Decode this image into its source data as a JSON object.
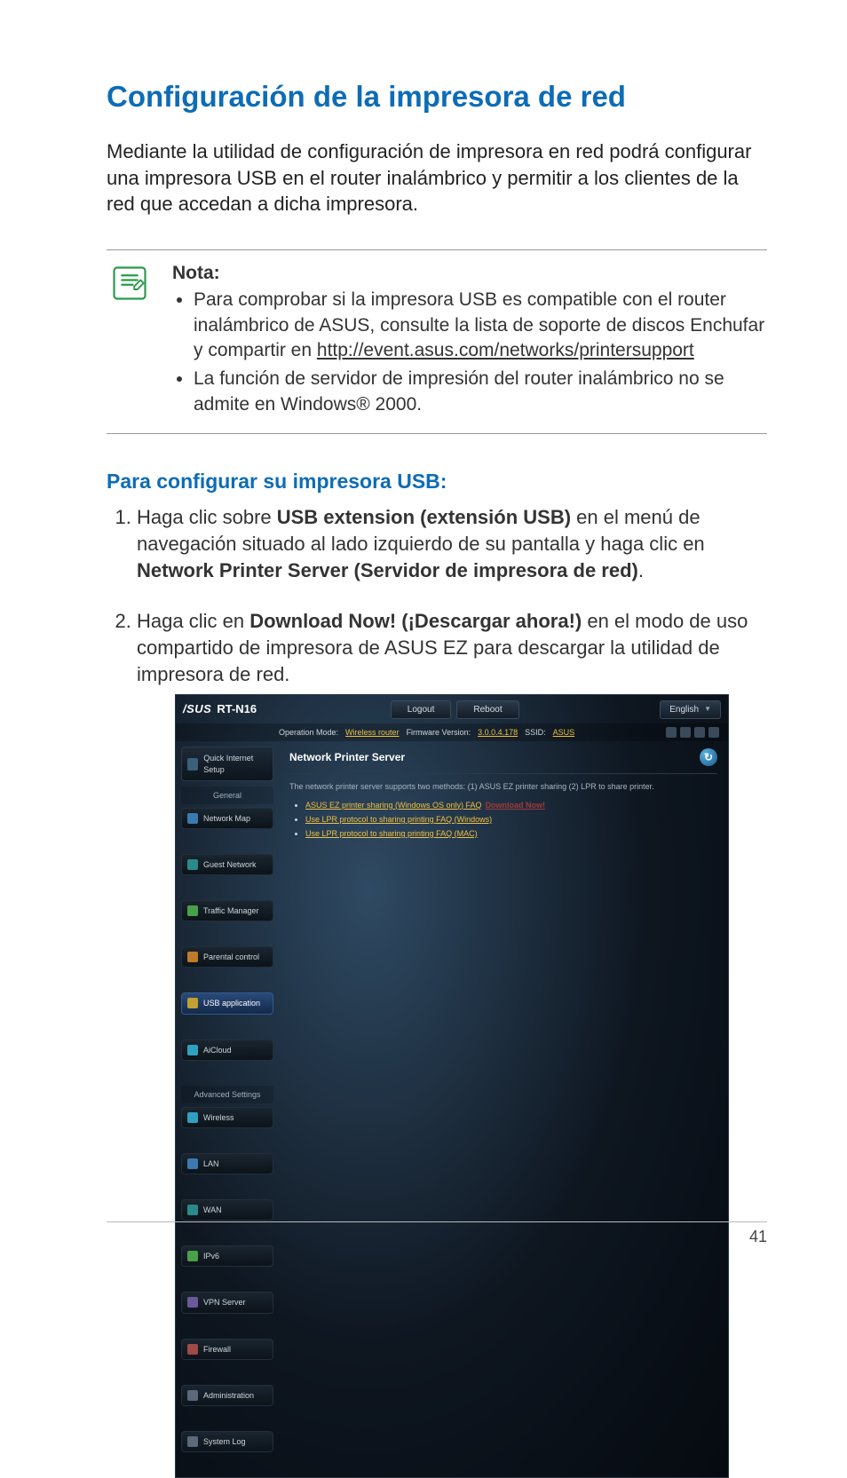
{
  "title": "Configuración de la impresora de red",
  "intro": "Mediante la utilidad de configuración de impresora en red podrá configurar una impresora USB en el router inalámbrico y permitir a los clientes de la red que accedan a dicha impresora.",
  "note": {
    "heading": "Nota:",
    "bullet1_pre": "Para comprobar si la impresora USB es compatible con el router inalámbrico de ASUS, consulte la lista de soporte de discos Enchufar y compartir en ",
    "bullet1_link": "http://event.asus.com/networks/printersupport",
    "bullet2": "La función de servidor de impresión del router inalámbrico no se admite en Windows® 2000."
  },
  "subheading": "Para configurar su impresora USB:",
  "step1": {
    "pre": "Haga clic sobre ",
    "bold1": "USB extension (extensión USB)",
    "mid": " en el menú de navegación situado al lado izquierdo de su pantalla y haga clic en ",
    "bold2": "Network Printer Server (Servidor de impresora de red)",
    "post": "."
  },
  "step2": {
    "pre": "Haga clic en ",
    "bold1": "Download Now! (¡Descargar ahora!)",
    "post": " en el modo de uso compartido de impresora de ASUS EZ para descargar la utilidad de impresora de red."
  },
  "screenshot": {
    "brand": "/SUS",
    "model": "RT-N16",
    "btn_logout": "Logout",
    "btn_reboot": "Reboot",
    "lang": "English",
    "info_mode_label": "Operation Mode:",
    "info_mode_value": "Wireless router",
    "info_fw_label": "Firmware Version:",
    "info_fw_value": "3.0.0.4.178",
    "info_ssid_label": "SSID:",
    "info_ssid_value": "ASUS",
    "side": {
      "qis": "Quick Internet Setup",
      "sec_general": "General",
      "items_general": [
        "Network Map",
        "Guest Network",
        "Traffic Manager",
        "Parental control",
        "USB application",
        "AiCloud"
      ],
      "sec_adv": "Advanced Settings",
      "items_adv": [
        "Wireless",
        "LAN",
        "WAN",
        "IPv6",
        "VPN Server",
        "Firewall",
        "Administration",
        "System Log"
      ]
    },
    "main": {
      "title": "Network Printer Server",
      "desc": "The network printer server supports two methods: (1) ASUS EZ printer sharing (2) LPR to share printer.",
      "link1": "ASUS EZ printer sharing (Windows OS only) FAQ",
      "link1_dl": "Download Now!",
      "link2": "Use LPR protocol to sharing printing FAQ (Windows)",
      "link3": "Use LPR protocol to sharing printing FAQ (MAC)"
    }
  },
  "page_number": "41"
}
